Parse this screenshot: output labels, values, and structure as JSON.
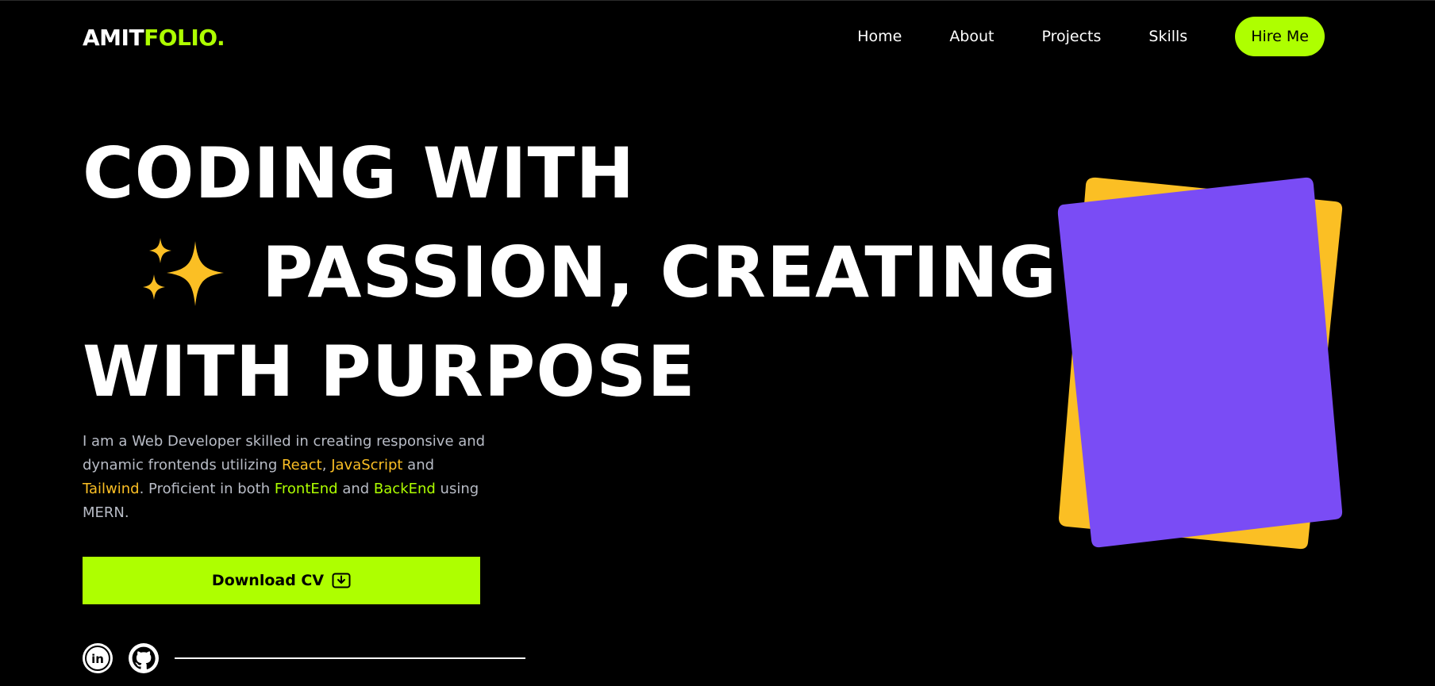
{
  "logo": {
    "main": "AMIT",
    "accent": "FOLIO."
  },
  "nav": {
    "links": [
      {
        "label": "Home"
      },
      {
        "label": "About"
      },
      {
        "label": "Projects"
      },
      {
        "label": "Skills"
      }
    ],
    "cta_label": "Hire Me"
  },
  "hero": {
    "line1": "CODING WITH",
    "line2": "PASSION, CREATING",
    "line3": "WITH PURPOSE",
    "sparkle_icon": "sparkles-icon"
  },
  "description": {
    "part1": "I am a Web Developer skilled in creating responsive and dynamic frontends utilizing ",
    "react": "React",
    "comma": ", ",
    "javascript": "JavaScript",
    "and1": " and ",
    "tailwind": "Tailwind",
    "part2": ". Proficient in both ",
    "frontend": "FrontEnd",
    "and2": " and ",
    "backend": "BackEnd",
    "part3": " using MERN."
  },
  "download": {
    "label": "Download CV",
    "icon": "download-icon"
  },
  "social": [
    {
      "name": "linkedin-icon",
      "label": "in"
    },
    {
      "name": "github-icon",
      "label": ""
    }
  ],
  "colors": {
    "accent": "#aeff00",
    "highlight_yellow": "#fbbf24",
    "card_purple": "#7a4cf5",
    "card_yellow": "#fbbf24",
    "background": "#000000"
  }
}
